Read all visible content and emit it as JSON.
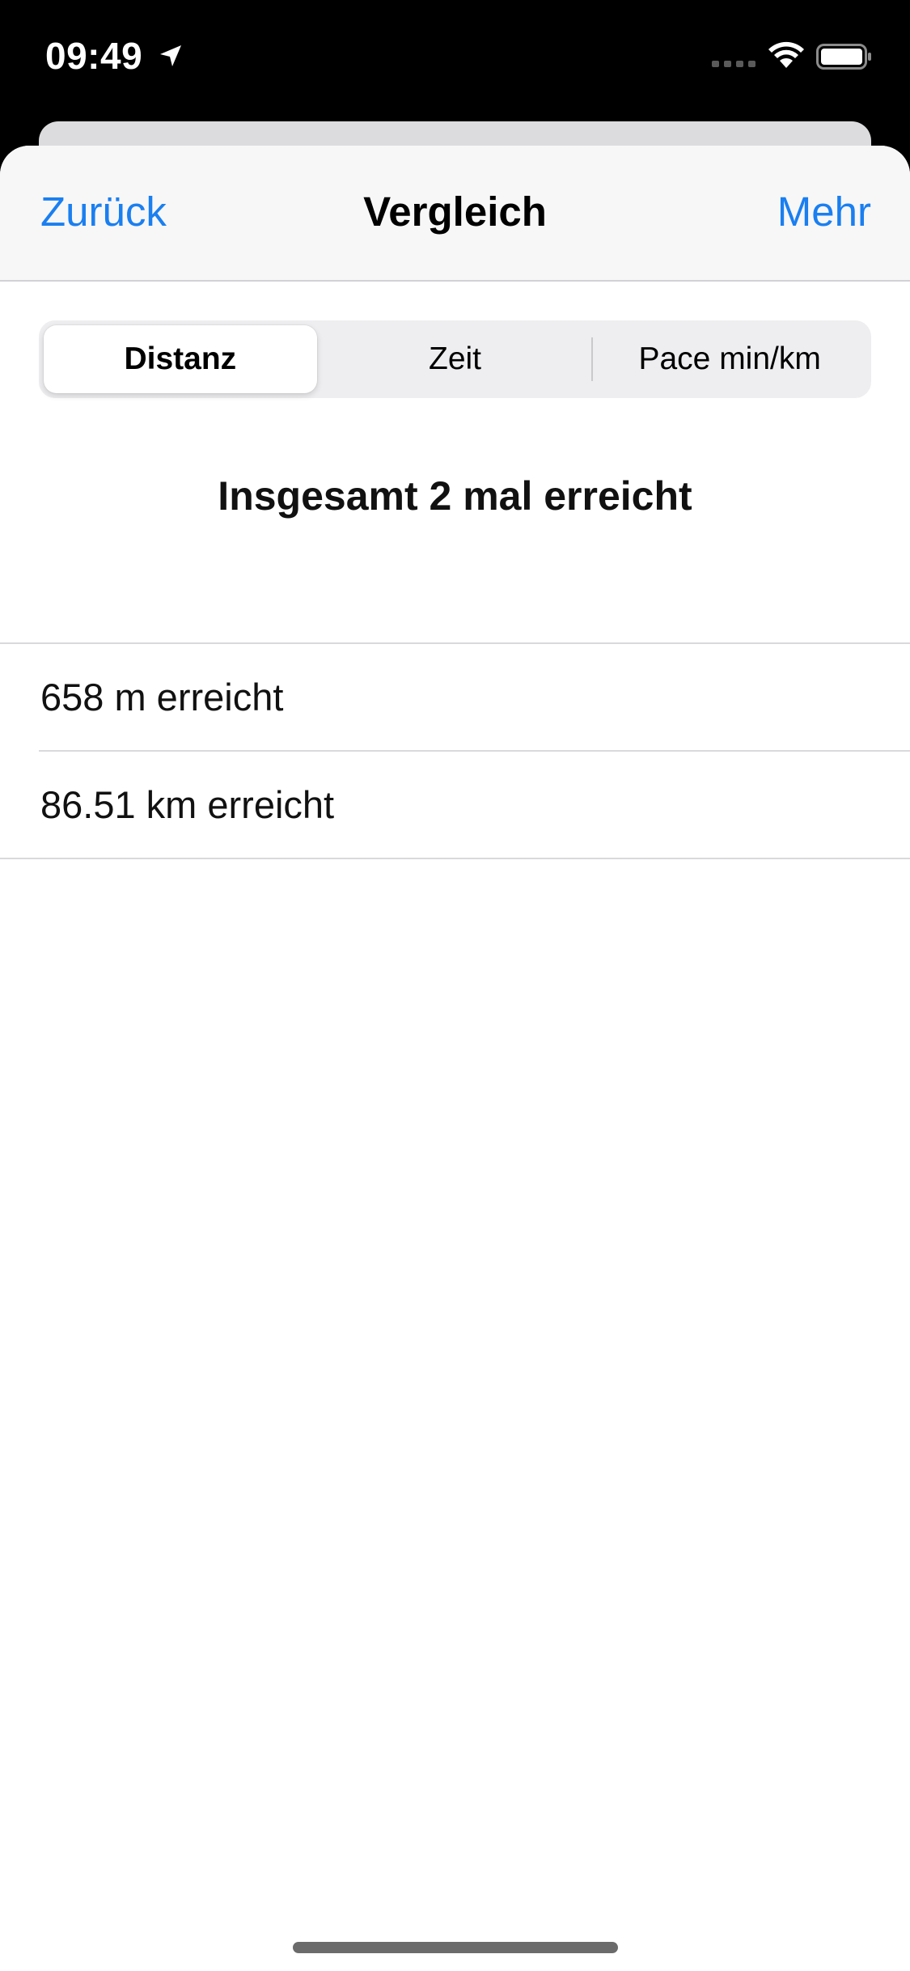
{
  "status_bar": {
    "time": "09:49",
    "icons": [
      "location-arrow-icon",
      "signal-icon",
      "wifi-icon",
      "battery-icon"
    ]
  },
  "nav": {
    "back_label": "Zurück",
    "title": "Vergleich",
    "more_label": "Mehr",
    "accent_color": "#1a7ff0"
  },
  "segments": [
    {
      "label": "Distanz",
      "selected": true
    },
    {
      "label": "Zeit",
      "selected": false
    },
    {
      "label": "Pace min/km",
      "selected": false
    }
  ],
  "summary": "Insgesamt 2 mal erreicht",
  "list": [
    {
      "text": "658 m erreicht"
    },
    {
      "text": "86.51 km erreicht"
    }
  ]
}
